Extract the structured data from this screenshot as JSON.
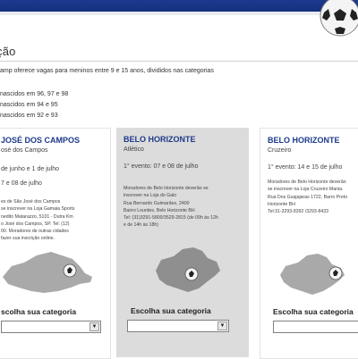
{
  "header": {
    "ball_icon": "soccer-ball-icon"
  },
  "page": {
    "section_title": "ção",
    "intro_text": "amp oferece vagas para meninos entre 9 e 15 anos, divididos nas categorias",
    "categories": [
      "nascidos em 96, 97 e 98",
      "nascidos em 94 e 95",
      "nascidos em 92 e 93"
    ]
  },
  "cards": [
    {
      "city": "JOSÉ DOS CAMPOS",
      "team": "osé dos Campos",
      "events": [
        "de junho e 1 de julho",
        "7 e 08 de julho"
      ],
      "description": [
        "es de São José dos Campos",
        "se inscrever na Loja Gamaia Sports",
        "nedito Matarazzo, 5101 - Dutra Km",
        "o José dos Campos, SP. Tel: (12)",
        "00. Moradores de outras cidades",
        "fazer sua inscrição online."
      ],
      "choose_label": "scolha sua categoria",
      "select_value": ""
    },
    {
      "city": "BELO HORIZONTE",
      "team": "Atlético",
      "events": [
        "1° evento: 07 e 08 de julho"
      ],
      "description": [
        "Moradores de Belo Horizonte deverão se",
        "inscrever na Loja do Galo",
        "Rua Bernardo Guimarães, 2400",
        "Bairro Lourdes, Belo Horizonte BH",
        "Tel: (31)3291-5800/3529-2815 (de 09h às 12h",
        "e de 14h às 18h)"
      ],
      "choose_label": "Escolha sua categoria",
      "select_value": ""
    },
    {
      "city": "BELO HORIZONTE",
      "team": "Cruzeiro",
      "events": [
        "1° evento: 14 e 15 de julho"
      ],
      "description": [
        "Moradores de Belo Horizonte deverão",
        "se inscrever na Loja Cruzeiro Mania.",
        "Rua Dos Guajajaras 1722, Barro Preto",
        "Horizonte BH",
        "Tel:31-3293-8392 /3293-8433"
      ],
      "choose_label": "Escolha sua categoria",
      "select_value": ""
    }
  ]
}
